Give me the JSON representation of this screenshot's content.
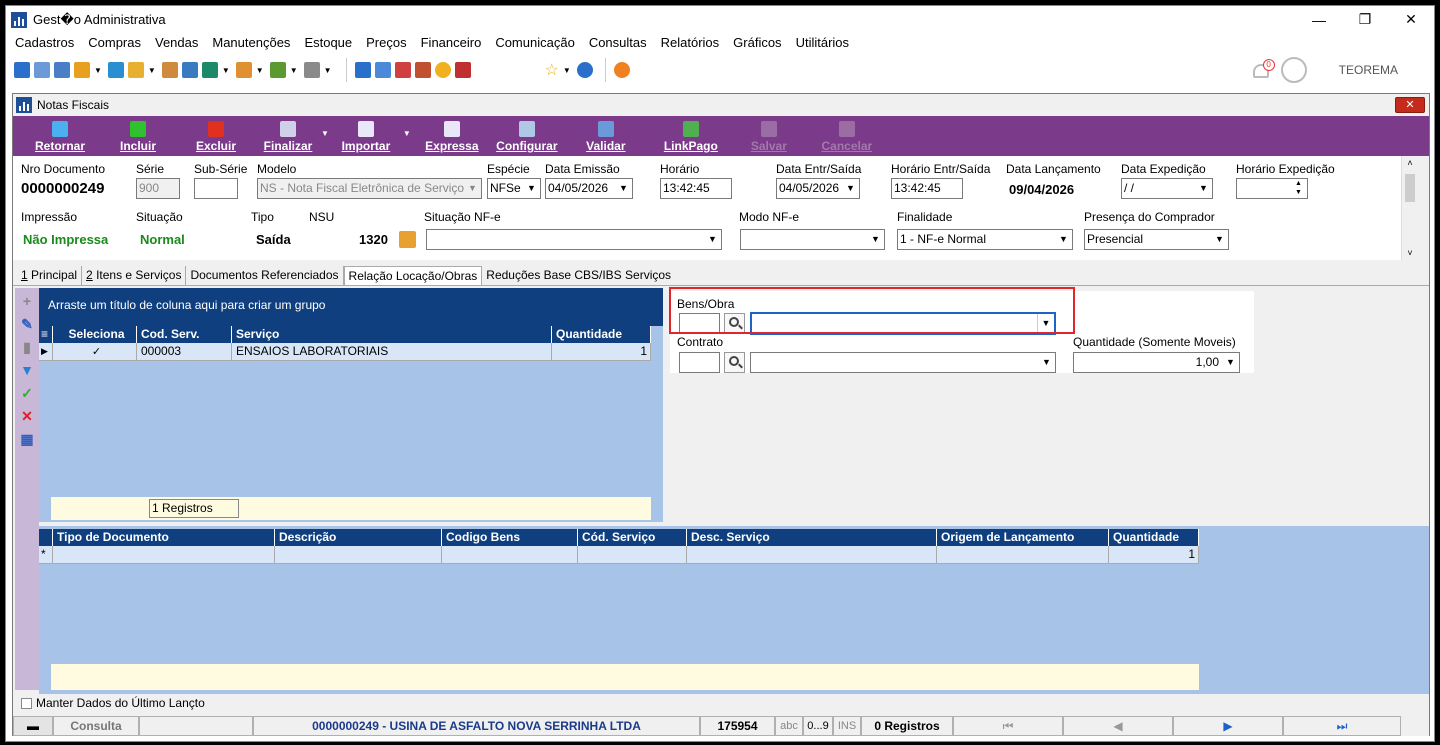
{
  "window": {
    "title": "Gest�o Administrativa"
  },
  "menu": [
    "Cadastros",
    "Compras",
    "Vendas",
    "Manutenções",
    "Estoque",
    "Preços",
    "Financeiro",
    "Comunicação",
    "Consultas",
    "Relatórios",
    "Gráficos",
    "Utilitários"
  ],
  "topbar": {
    "notification_count": "0",
    "user": "TEOREMA"
  },
  "child": {
    "title": "Notas Fiscais",
    "close_label": "✕"
  },
  "toolbar": {
    "retornar": "Retornar",
    "incluir": "Incluir",
    "excluir": "Excluir",
    "finalizar": "Finalizar",
    "importar": "Importar",
    "expressa": "Expressa",
    "configurar": "Configurar",
    "validar": "Validar",
    "linkpago": "LinkPago",
    "salvar": "Salvar",
    "cancelar": "Cancelar"
  },
  "header": {
    "nro_documento_label": "Nro Documento",
    "nro_documento": "0000000249",
    "serie_label": "Série",
    "serie": "900",
    "subserie_label": "Sub-Série",
    "subserie": "",
    "modelo_label": "Modelo",
    "modelo": "NS - Nota Fiscal Eletrônica de Serviço",
    "especie_label": "Espécie",
    "especie": "NFSe",
    "data_emissao_label": "Data Emissão",
    "data_emissao": "04/05/2026",
    "horario_label": "Horário",
    "horario": "13:42:45",
    "data_entr_label": "Data Entr/Saída",
    "data_entr": "04/05/2026",
    "horario_entr_label": "Horário Entr/Saída",
    "horario_entr": "13:42:45",
    "data_lanc_label": "Data Lançamento",
    "data_lanc": "09/04/2026",
    "data_exped_label": "Data Expedição",
    "data_exped": " / /",
    "horario_exped_label": "Horário Expedição",
    "horario_exped": "",
    "impressao_label": "Impressão",
    "impressao": "Não Impressa",
    "situacao_label": "Situação",
    "situacao": "Normal",
    "tipo_label": "Tipo",
    "tipo": "Saída",
    "nsu_label": "NSU",
    "nsu": "1320",
    "situacao_nfe_label": "Situação NF-e",
    "situacao_nfe": "",
    "modo_nfe_label": "Modo NF-e",
    "modo_nfe": "",
    "finalidade_label": "Finalidade",
    "finalidade": "1 - NF-e Normal",
    "presenca_label": "Presença do Comprador",
    "presenca": "Presencial"
  },
  "tabs": [
    {
      "key": "1",
      "rest": " Principal"
    },
    {
      "key": "2",
      "rest": " Itens e Serviços"
    },
    {
      "key": "",
      "rest": "Documentos Referenciados"
    },
    {
      "key": "",
      "rest": "Relação Locação/Obras"
    },
    {
      "key": "",
      "rest": "Reduções Base CBS/IBS Serviços"
    }
  ],
  "services_grid": {
    "group_hint": "Arraste um título de coluna aqui para criar um grupo",
    "columns": [
      "Seleciona",
      "Cod. Serv.",
      "Serviço",
      "Quantidade"
    ],
    "rows": [
      {
        "seleciona": "✓",
        "cod": "000003",
        "servico": "ENSAIOS LABORATORIAIS",
        "quantidade": "1"
      }
    ],
    "records": "1 Registros"
  },
  "form": {
    "bens_label": "Bens/Obra",
    "bens_code": "",
    "bens_value": "",
    "contrato_label": "Contrato",
    "contrato_code": "",
    "contrato_value": "",
    "quantidade_label": "Quantidade (Somente Moveis)",
    "quantidade": "1,00"
  },
  "relation_grid": {
    "columns": [
      "Tipo de Documento",
      "Descrição",
      "Codigo Bens",
      "Cód. Serviço",
      "Desc. Serviço",
      "Origem de Lançamento",
      "Quantidade"
    ],
    "new_row_marker": "*",
    "new_row_quantity": "1"
  },
  "keep_data_label": "Manter Dados do Último Lançto",
  "statusbar": {
    "mode": "Consulta",
    "document": "0000000249 - USINA DE ASFALTO NOVA SERRINHA LTDA",
    "code": "175954",
    "abc": "abc",
    "range": "0...9",
    "ins": "INS",
    "records": "0 Registros"
  },
  "colors": {
    "toolbar": "#7b3a8a",
    "grid_header": "#0f3f7f",
    "grid_bg": "#a7c3e8",
    "highlight": "#e0262d"
  }
}
